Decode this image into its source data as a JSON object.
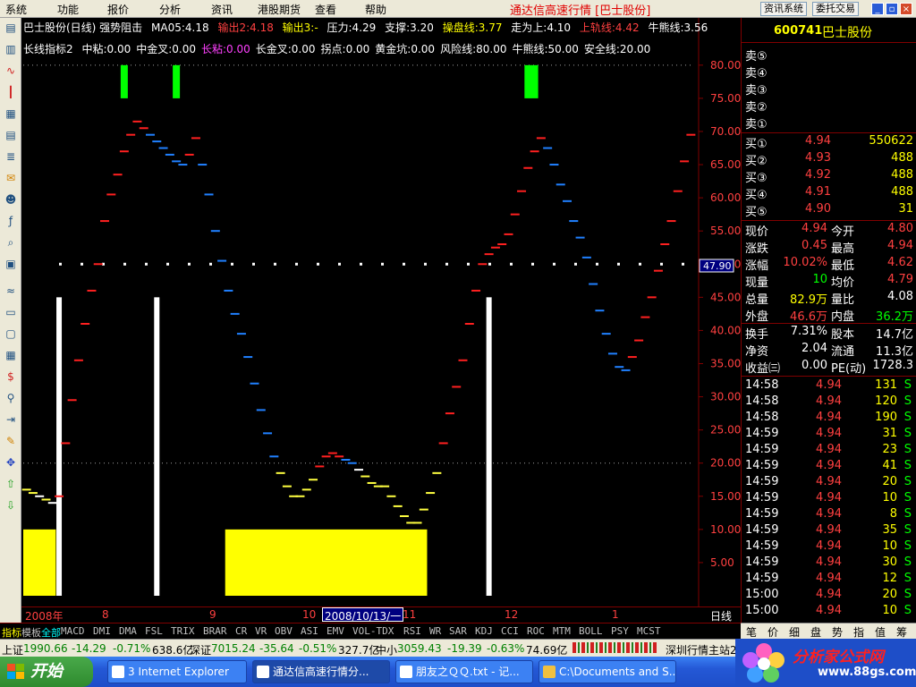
{
  "menu": [
    "系统",
    "功能",
    "报价",
    "分析",
    "资讯",
    "港股期货",
    "查看",
    "帮助"
  ],
  "app_title": "通达信高速行情 [巴士股份]",
  "top_buttons": [
    "资讯系统",
    "委托交易"
  ],
  "chart_info": {
    "name": "巴士股份(日线) 强势阻击",
    "ma": "MA05:4.18",
    "out2": "输出2:4.18",
    "out3": "输出3:-",
    "pressure": "压力:4.29",
    "support": "支撑:3.20",
    "pan": "操盘线:3.77",
    "trend": "走为上:4.10",
    "up": "上轨线:4.42",
    "bull": "牛熊线:3.56"
  },
  "indicator_info": {
    "name": "长线指标2",
    "items": [
      {
        "label": "中粘:0.00",
        "color": "#ffffff"
      },
      {
        "label": "中金叉:0.00",
        "color": "#ffffff"
      },
      {
        "label": "长粘:0.00",
        "color": "#ff40ff"
      },
      {
        "label": "长金叉:0.00",
        "color": "#ffffff"
      },
      {
        "label": "拐点:0.00",
        "color": "#ffffff"
      },
      {
        "label": "黄金坑:0.00",
        "color": "#ffffff"
      },
      {
        "label": "风险线:80.00",
        "color": "#ffffff"
      },
      {
        "label": "牛熊线:50.00",
        "color": "#ffffff"
      },
      {
        "label": "安全线:20.00",
        "color": "#ffffff"
      }
    ]
  },
  "cursor_value": "47.90",
  "stock": {
    "code": "600741",
    "name": "巴士股份"
  },
  "asks": [
    {
      "label": "卖⑤",
      "price": "",
      "vol": ""
    },
    {
      "label": "卖④",
      "price": "",
      "vol": ""
    },
    {
      "label": "卖③",
      "price": "",
      "vol": ""
    },
    {
      "label": "卖②",
      "price": "",
      "vol": ""
    },
    {
      "label": "卖①",
      "price": "",
      "vol": ""
    }
  ],
  "bids": [
    {
      "label": "买①",
      "price": "4.94",
      "vol": "550622"
    },
    {
      "label": "买②",
      "price": "4.93",
      "vol": "488"
    },
    {
      "label": "买③",
      "price": "4.92",
      "vol": "488"
    },
    {
      "label": "买④",
      "price": "4.91",
      "vol": "488"
    },
    {
      "label": "买⑤",
      "price": "4.90",
      "vol": "31"
    }
  ],
  "quote": [
    {
      "l1": "现价",
      "v1": "4.94",
      "c1": "#ff4040",
      "l2": "今开",
      "v2": "4.80",
      "c2": "#ff4040"
    },
    {
      "l1": "涨跌",
      "v1": "0.45",
      "c1": "#ff4040",
      "l2": "最高",
      "v2": "4.94",
      "c2": "#ff4040"
    },
    {
      "l1": "涨幅",
      "v1": "10.02%",
      "c1": "#ff4040",
      "l2": "最低",
      "v2": "4.62",
      "c2": "#ff4040"
    },
    {
      "l1": "现量",
      "v1": "10",
      "c1": "#00ff00",
      "l2": "均价",
      "v2": "4.79",
      "c2": "#ff4040"
    },
    {
      "l1": "总量",
      "v1": "82.9万",
      "c1": "#ffff00",
      "l2": "量比",
      "v2": "4.08",
      "c2": "#ffffff"
    },
    {
      "l1": "外盘",
      "v1": "46.6万",
      "c1": "#ff4040",
      "l2": "内盘",
      "v2": "36.2万",
      "c2": "#00ff00"
    }
  ],
  "quote2": [
    {
      "l1": "换手",
      "v1": "7.31%",
      "l2": "股本",
      "v2": "14.7亿"
    },
    {
      "l1": "净资",
      "v1": "2.04",
      "l2": "流通",
      "v2": "11.3亿"
    },
    {
      "l1": "收益㈢",
      "v1": "0.00",
      "l2": "PE(动)",
      "v2": "1728.3"
    }
  ],
  "ticks": [
    {
      "t": "14:58",
      "p": "4.94",
      "v": "131",
      "s": "S"
    },
    {
      "t": "14:58",
      "p": "4.94",
      "v": "120",
      "s": "S"
    },
    {
      "t": "14:58",
      "p": "4.94",
      "v": "190",
      "s": "S"
    },
    {
      "t": "14:59",
      "p": "4.94",
      "v": "31",
      "s": "S"
    },
    {
      "t": "14:59",
      "p": "4.94",
      "v": "23",
      "s": "S"
    },
    {
      "t": "14:59",
      "p": "4.94",
      "v": "41",
      "s": "S"
    },
    {
      "t": "14:59",
      "p": "4.94",
      "v": "20",
      "s": "S"
    },
    {
      "t": "14:59",
      "p": "4.94",
      "v": "10",
      "s": "S"
    },
    {
      "t": "14:59",
      "p": "4.94",
      "v": "8",
      "s": "S"
    },
    {
      "t": "14:59",
      "p": "4.94",
      "v": "35",
      "s": "S"
    },
    {
      "t": "14:59",
      "p": "4.94",
      "v": "10",
      "s": "S"
    },
    {
      "t": "14:59",
      "p": "4.94",
      "v": "30",
      "s": "S"
    },
    {
      "t": "14:59",
      "p": "4.94",
      "v": "12",
      "s": "S"
    },
    {
      "t": "15:00",
      "p": "4.94",
      "v": "20",
      "s": "S"
    },
    {
      "t": "15:00",
      "p": "4.94",
      "v": "10",
      "s": "S"
    }
  ],
  "right_tabs": [
    "笔",
    "价",
    "细",
    "盘",
    "势",
    "指",
    "值",
    "筹"
  ],
  "date_labels": [
    "2008年",
    "8",
    "9",
    "10",
    "11",
    "12",
    "1"
  ],
  "date_cursor": "2008/10/13/一",
  "period_label": "日线",
  "indicator_tabs": [
    "指标",
    "模板",
    "全部",
    "MACD",
    "DMI",
    "DMA",
    "FSL",
    "TRIX",
    "BRAR",
    "CR",
    "VR",
    "OBV",
    "ASI",
    "EMV",
    "VOL-TDX",
    "RSI",
    "WR",
    "SAR",
    "KDJ",
    "CCI",
    "ROC",
    "MTM",
    "BOLL",
    "PSY",
    "MCST"
  ],
  "status": {
    "sh_label": "上证",
    "sh_val": "1990.66",
    "sh_chg": "-14.29",
    "sh_pct": "-0.71%",
    "sh_amt": "638.6亿",
    "sz_label": "深证",
    "sz_val": "7015.24",
    "sz_chg": "-35.64",
    "sz_pct": "-0.51%",
    "sz_amt": "327.7亿",
    "zx_label": "中小",
    "zx_val": "3059.43",
    "zx_chg": "-19.39",
    "zx_pct": "-0.63%",
    "zx_amt": "74.69亿",
    "server": "深圳行情主站2"
  },
  "taskbar": {
    "start": "开始",
    "tasks": [
      "3 Internet Explorer",
      "通达信高速行情分...",
      "朋友之ＱＱ.txt - 记...",
      "C:\\Documents and S..."
    ]
  },
  "watermark": {
    "text": "分析家公式网",
    "url": "www.88gs.com"
  },
  "chart_data": {
    "type": "scatter",
    "y_ticks": [
      "80.00",
      "75.00",
      "70.00",
      "65.00",
      "60.00",
      "55.00",
      "50.00",
      "45.00",
      "40.00",
      "35.00",
      "30.00",
      "25.00",
      "20.00",
      "15.00",
      "10.00",
      "5.00"
    ],
    "ylim": [
      0,
      82
    ],
    "ref_lines": [
      80,
      50,
      20
    ],
    "colors": {
      "red": "#ff2020",
      "blue": "#2080ff",
      "yellow": "#ffff40",
      "white": "#ffffff",
      "green": "#00ff00",
      "grid": "#800000"
    },
    "points": [
      {
        "x": 0,
        "y": 16,
        "c": "yellow"
      },
      {
        "x": 1,
        "y": 15.5,
        "c": "yellow"
      },
      {
        "x": 2,
        "y": 15,
        "c": "white"
      },
      {
        "x": 3,
        "y": 14.5,
        "c": "yellow"
      },
      {
        "x": 4,
        "y": 14,
        "c": "white"
      },
      {
        "x": 5,
        "y": 15,
        "c": "red"
      },
      {
        "x": 6,
        "y": 23,
        "c": "red"
      },
      {
        "x": 7,
        "y": 29.5,
        "c": "red"
      },
      {
        "x": 8,
        "y": 35.5,
        "c": "red"
      },
      {
        "x": 9,
        "y": 41,
        "c": "red"
      },
      {
        "x": 10,
        "y": 46,
        "c": "red"
      },
      {
        "x": 11,
        "y": 50,
        "c": "red"
      },
      {
        "x": 12,
        "y": 56.5,
        "c": "red"
      },
      {
        "x": 13,
        "y": 60.5,
        "c": "red"
      },
      {
        "x": 14,
        "y": 63.5,
        "c": "red"
      },
      {
        "x": 15,
        "y": 67,
        "c": "red"
      },
      {
        "x": 16,
        "y": 69.5,
        "c": "red"
      },
      {
        "x": 17,
        "y": 71.5,
        "c": "red"
      },
      {
        "x": 18,
        "y": 70.5,
        "c": "red"
      },
      {
        "x": 19,
        "y": 69.5,
        "c": "blue"
      },
      {
        "x": 20,
        "y": 68.5,
        "c": "blue"
      },
      {
        "x": 21,
        "y": 67.5,
        "c": "blue"
      },
      {
        "x": 22,
        "y": 66.5,
        "c": "blue"
      },
      {
        "x": 23,
        "y": 65.5,
        "c": "blue"
      },
      {
        "x": 24,
        "y": 65,
        "c": "blue"
      },
      {
        "x": 25,
        "y": 66.5,
        "c": "red"
      },
      {
        "x": 26,
        "y": 69,
        "c": "red"
      },
      {
        "x": 27,
        "y": 65,
        "c": "blue"
      },
      {
        "x": 28,
        "y": 60.5,
        "c": "blue"
      },
      {
        "x": 29,
        "y": 55,
        "c": "blue"
      },
      {
        "x": 30,
        "y": 50.5,
        "c": "blue"
      },
      {
        "x": 31,
        "y": 46,
        "c": "blue"
      },
      {
        "x": 32,
        "y": 42.5,
        "c": "blue"
      },
      {
        "x": 33,
        "y": 39.5,
        "c": "blue"
      },
      {
        "x": 34,
        "y": 36,
        "c": "blue"
      },
      {
        "x": 35,
        "y": 32,
        "c": "blue"
      },
      {
        "x": 36,
        "y": 28,
        "c": "blue"
      },
      {
        "x": 37,
        "y": 24.5,
        "c": "blue"
      },
      {
        "x": 38,
        "y": 21,
        "c": "blue"
      },
      {
        "x": 39,
        "y": 18.5,
        "c": "yellow"
      },
      {
        "x": 40,
        "y": 16.5,
        "c": "yellow"
      },
      {
        "x": 41,
        "y": 15,
        "c": "yellow"
      },
      {
        "x": 42,
        "y": 15,
        "c": "yellow"
      },
      {
        "x": 43,
        "y": 16,
        "c": "yellow"
      },
      {
        "x": 44,
        "y": 17.5,
        "c": "yellow"
      },
      {
        "x": 45,
        "y": 19.5,
        "c": "red"
      },
      {
        "x": 46,
        "y": 21,
        "c": "red"
      },
      {
        "x": 47,
        "y": 21.5,
        "c": "red"
      },
      {
        "x": 48,
        "y": 21,
        "c": "red"
      },
      {
        "x": 49,
        "y": 20.5,
        "c": "blue"
      },
      {
        "x": 50,
        "y": 20,
        "c": "blue"
      },
      {
        "x": 51,
        "y": 19,
        "c": "white"
      },
      {
        "x": 52,
        "y": 18,
        "c": "yellow"
      },
      {
        "x": 53,
        "y": 17,
        "c": "yellow"
      },
      {
        "x": 54,
        "y": 16.5,
        "c": "yellow"
      },
      {
        "x": 55,
        "y": 16.5,
        "c": "yellow"
      },
      {
        "x": 56,
        "y": 15,
        "c": "yellow"
      },
      {
        "x": 57,
        "y": 13.5,
        "c": "yellow"
      },
      {
        "x": 58,
        "y": 12,
        "c": "yellow"
      },
      {
        "x": 59,
        "y": 11,
        "c": "yellow"
      },
      {
        "x": 60,
        "y": 11,
        "c": "yellow"
      },
      {
        "x": 61,
        "y": 13,
        "c": "yellow"
      },
      {
        "x": 62,
        "y": 15.5,
        "c": "yellow"
      },
      {
        "x": 63,
        "y": 18.5,
        "c": "yellow"
      },
      {
        "x": 64,
        "y": 23,
        "c": "red"
      },
      {
        "x": 65,
        "y": 27.5,
        "c": "red"
      },
      {
        "x": 66,
        "y": 31.5,
        "c": "red"
      },
      {
        "x": 67,
        "y": 35.5,
        "c": "red"
      },
      {
        "x": 68,
        "y": 41,
        "c": "red"
      },
      {
        "x": 69,
        "y": 46,
        "c": "red"
      },
      {
        "x": 70,
        "y": 50,
        "c": "red"
      },
      {
        "x": 71,
        "y": 51.5,
        "c": "red"
      },
      {
        "x": 72,
        "y": 52.5,
        "c": "red"
      },
      {
        "x": 73,
        "y": 53,
        "c": "red"
      },
      {
        "x": 74,
        "y": 54.5,
        "c": "red"
      },
      {
        "x": 75,
        "y": 57.5,
        "c": "red"
      },
      {
        "x": 76,
        "y": 61,
        "c": "red"
      },
      {
        "x": 77,
        "y": 64.5,
        "c": "red"
      },
      {
        "x": 78,
        "y": 67,
        "c": "red"
      },
      {
        "x": 79,
        "y": 69,
        "c": "red"
      },
      {
        "x": 80,
        "y": 67.5,
        "c": "blue"
      },
      {
        "x": 81,
        "y": 65,
        "c": "blue"
      },
      {
        "x": 82,
        "y": 62,
        "c": "blue"
      },
      {
        "x": 83,
        "y": 59.5,
        "c": "blue"
      },
      {
        "x": 84,
        "y": 56.5,
        "c": "blue"
      },
      {
        "x": 85,
        "y": 54,
        "c": "blue"
      },
      {
        "x": 86,
        "y": 51,
        "c": "blue"
      },
      {
        "x": 87,
        "y": 47,
        "c": "blue"
      },
      {
        "x": 88,
        "y": 43,
        "c": "blue"
      },
      {
        "x": 89,
        "y": 39.5,
        "c": "blue"
      },
      {
        "x": 90,
        "y": 36.5,
        "c": "blue"
      },
      {
        "x": 91,
        "y": 34.5,
        "c": "blue"
      },
      {
        "x": 92,
        "y": 34,
        "c": "blue"
      },
      {
        "x": 93,
        "y": 36,
        "c": "red"
      },
      {
        "x": 94,
        "y": 38.5,
        "c": "red"
      },
      {
        "x": 95,
        "y": 42,
        "c": "red"
      },
      {
        "x": 96,
        "y": 45,
        "c": "red"
      },
      {
        "x": 97,
        "y": 49,
        "c": "red"
      },
      {
        "x": 98,
        "y": 53,
        "c": "red"
      },
      {
        "x": 99,
        "y": 56.5,
        "c": "red"
      },
      {
        "x": 100,
        "y": 61,
        "c": "red"
      },
      {
        "x": 101,
        "y": 65.5,
        "c": "red"
      },
      {
        "x": 102,
        "y": 69.5,
        "c": "red"
      }
    ],
    "white_bars": [
      {
        "x": 5,
        "y": 45
      },
      {
        "x": 20,
        "y": 45
      },
      {
        "x": 71,
        "y": 45
      }
    ],
    "yellow_blocks": [
      {
        "x0": 0,
        "x1": 4,
        "y": 10
      },
      {
        "x0": 31,
        "x1": 61,
        "y": 10
      }
    ],
    "green_bars": [
      {
        "x": 15,
        "y0": 75,
        "y1": 80
      },
      {
        "x": 23,
        "y0": 75,
        "y1": 80
      },
      {
        "x": 77,
        "y0": 75,
        "y1": 80
      },
      {
        "x": 78,
        "y0": 75,
        "y1": 80
      }
    ]
  }
}
